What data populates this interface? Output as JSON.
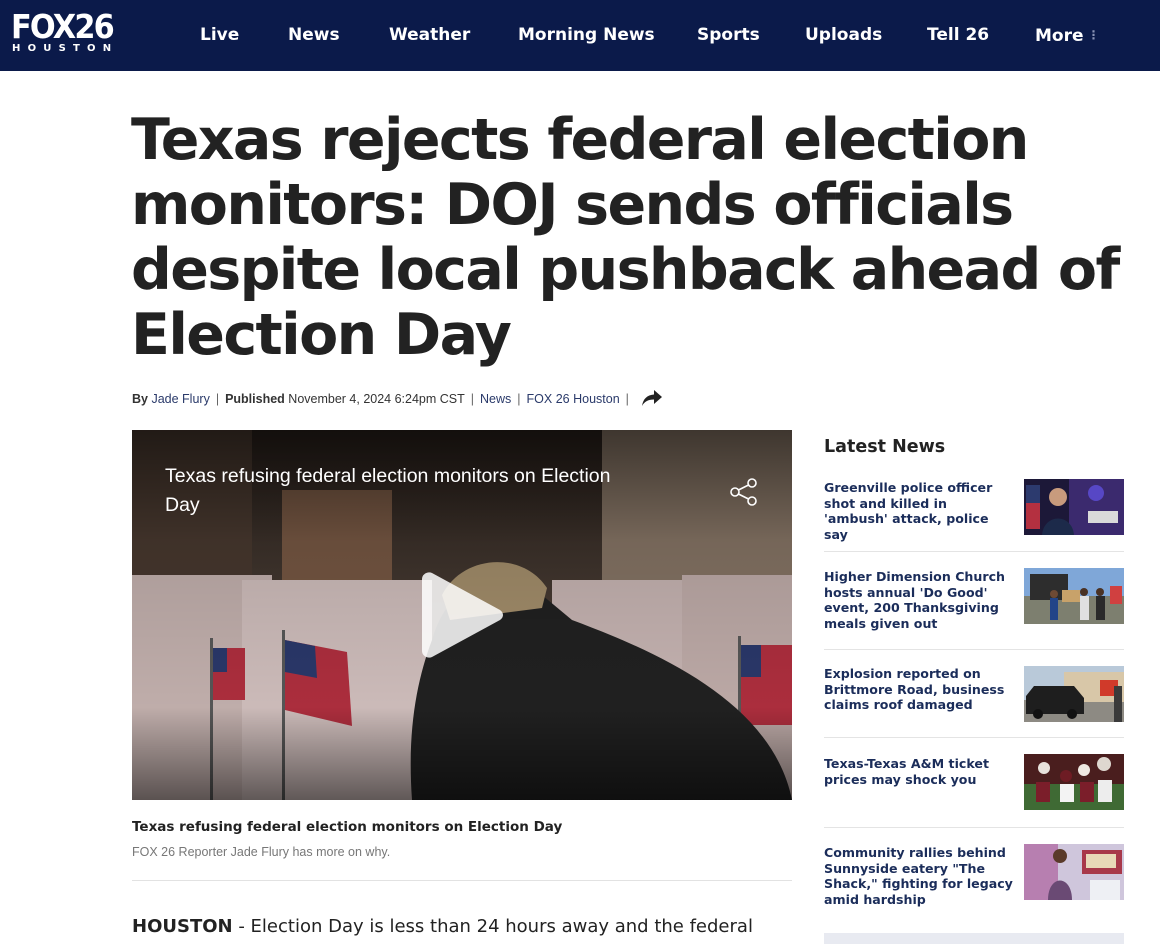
{
  "header": {
    "logo": {
      "main": "FOX26",
      "sub": "HOUSTON"
    },
    "nav": [
      "Live",
      "News",
      "Weather",
      "Morning News",
      "Sports",
      "Uploads",
      "Tell 26",
      "More"
    ],
    "more_icon": "vertical-dots-icon",
    "colors": {
      "background": "#0b1a4a",
      "text": "#ffffff"
    }
  },
  "article": {
    "headline": "Texas rejects federal election monitors: DOJ sends officials despite local pushback ahead of Election Day",
    "byline": {
      "by_label": "By",
      "author": "Jade Flury",
      "published_label": "Published",
      "published": "November 4, 2024 6:24pm CST",
      "section": "News",
      "source": "FOX 26 Houston",
      "share_icon": "share-arrow-icon"
    },
    "video": {
      "title": "Texas refusing federal election monitors on Election Day",
      "share_icon": "share-nodes-icon",
      "play_icon": "play-icon"
    },
    "caption": {
      "title": "Texas refusing federal election monitors on Election Day",
      "text": "FOX 26 Reporter Jade Flury has more on why."
    },
    "lede": {
      "dateline": "HOUSTON",
      "dash": " - ",
      "text": "Election Day is less than 24 hours away and the federal"
    }
  },
  "sidebar": {
    "title": "Latest News",
    "items": [
      {
        "headline": "Greenville police officer shot and killed in 'ambush' attack, police say"
      },
      {
        "headline": "Higher Dimension Church hosts annual 'Do Good' event, 200 Thanksgiving meals given out"
      },
      {
        "headline": "Explosion reported on Brittmore Road, business claims roof damaged"
      },
      {
        "headline": "Texas-Texas A&M ticket prices may shock you"
      },
      {
        "headline": "Community rallies behind Sunnyside eatery \"The Shack,\" fighting for legacy amid hardship"
      }
    ]
  }
}
